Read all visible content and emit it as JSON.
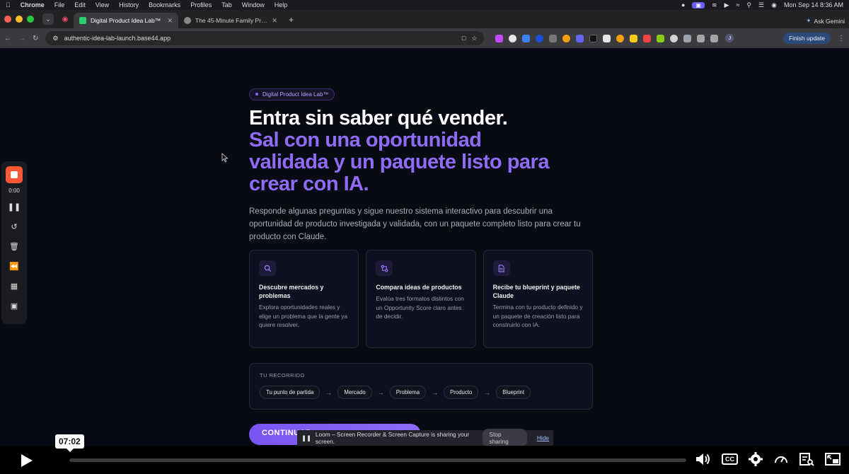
{
  "menubar": {
    "app": "Chrome",
    "items": [
      "File",
      "Edit",
      "View",
      "History",
      "Bookmarks",
      "Profiles",
      "Tab",
      "Window",
      "Help"
    ],
    "clock": "Mon Sep 14  8:36 AM"
  },
  "tabs": [
    {
      "title": "Digital Product Idea Lab™",
      "active": true,
      "icon_color": "#2ecc71"
    },
    {
      "title": "The 45-Minute Family Protein Pa",
      "active": false,
      "icon_color": "#888888"
    }
  ],
  "browser": {
    "url": "authentic-idea-lab-launch.base44.app",
    "ask_gemini": "Ask Gemini",
    "finish_update": "Finish update",
    "profile_initial": "J"
  },
  "hero": {
    "chip": "Digital Product Idea Lab™",
    "title_line1": "Entra sin saber qué vender.",
    "title_line2": "Sal con una oportunidad",
    "title_line3": "validada y un paquete listo para",
    "title_line4": "crear con IA.",
    "lead": "Responde algunas preguntas y sigue nuestro sistema interactivo para descubrir una oportunidad de producto investigada y validada, con un paquete completo listo para crear tu producto con Claude."
  },
  "cards": [
    {
      "icon": "search-icon",
      "title": "Descubre mercados y problemas",
      "desc": "Explora oportunidades reales y elige un problema que la gente ya quiere resolver."
    },
    {
      "icon": "compare-icon",
      "title": "Compara ideas de productos",
      "desc": "Evalúa tres formatos distintos con un Opportunity Score claro antes de decidir."
    },
    {
      "icon": "document-icon",
      "title": "Recibe tu blueprint y paquete Claude",
      "desc": "Termina con tu producto definido y un paquete de creación listo para construirlo con IA."
    }
  ],
  "journey": {
    "label": "TU RECORRIDO",
    "steps": [
      "Tu punto de partida",
      "Mercado",
      "Problema",
      "Producto",
      "Blueprint"
    ]
  },
  "cta": {
    "label": "CONTINUAR"
  },
  "loom": {
    "timer": "0:00",
    "share_text": "Loom – Screen Recorder & Screen Capture is sharing your screen.",
    "stop_sharing": "Stop sharing",
    "hide": "Hide"
  },
  "player": {
    "timestamp": "07:02",
    "cc": "CC"
  },
  "colors": {
    "accent": "#8f6bf6",
    "page_bg": "#080a14",
    "card_bg": "#0e1020"
  }
}
